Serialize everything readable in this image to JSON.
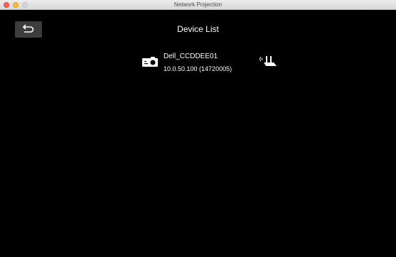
{
  "window": {
    "title": "Network Projection"
  },
  "header": {
    "title": "Device List",
    "back_icon": "back-arrow-icon"
  },
  "devices": [
    {
      "name": "Dell_CCDDEE01",
      "address": "10.0.50.100 (14720005)",
      "type_icon": "projector-icon",
      "connection_icon": "wireless-router-icon"
    }
  ],
  "colors": {
    "background": "#000000",
    "text": "#ffffff",
    "back_button": "#3d3d3d"
  }
}
